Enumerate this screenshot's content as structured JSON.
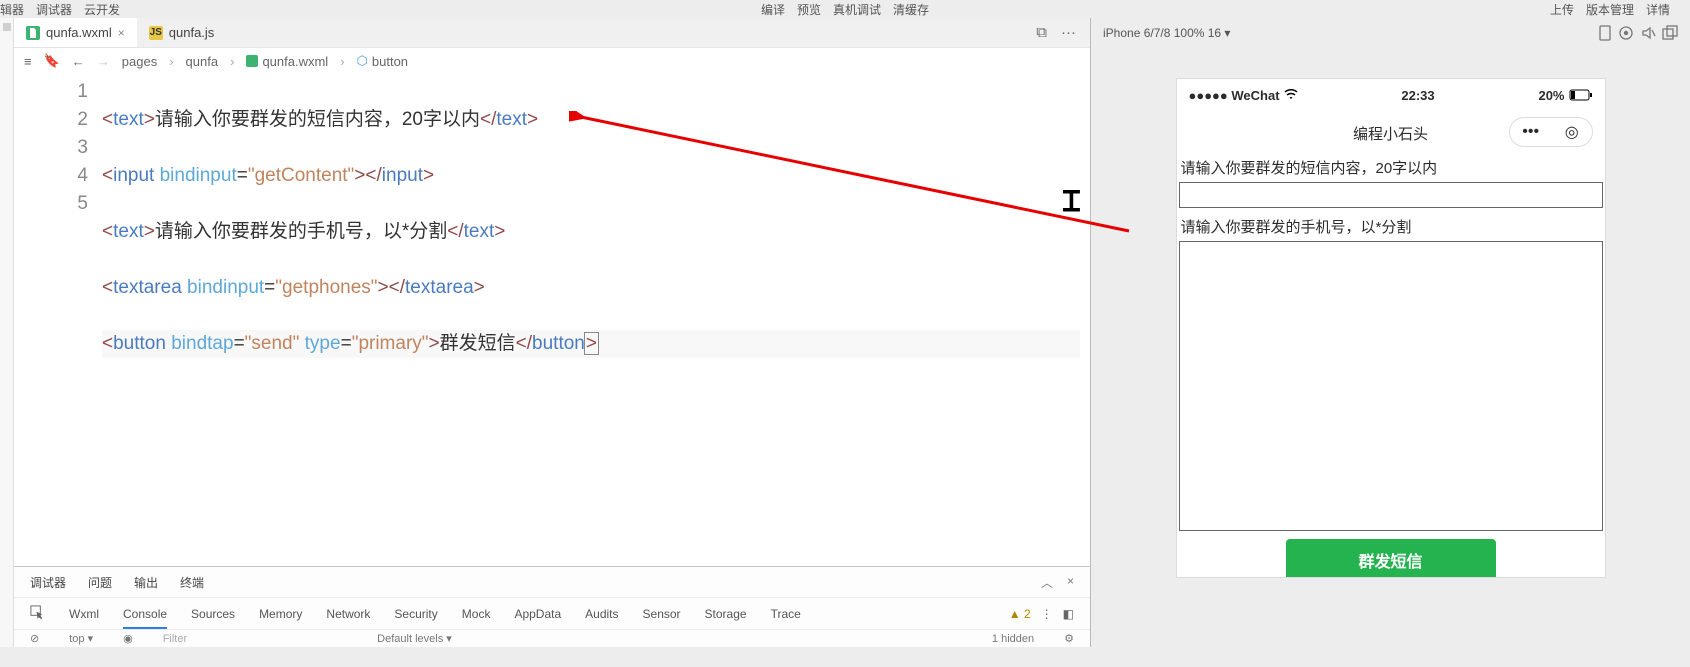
{
  "menu": {
    "left": [
      "辑器",
      "调试器",
      "云开发"
    ],
    "center": [
      "编译",
      "预览",
      "真机调试",
      "清缓存"
    ],
    "right": [
      "上传",
      "版本管理",
      "详情"
    ]
  },
  "tabs": {
    "items": [
      {
        "name": "qunfa.wxml",
        "active": true,
        "iconClass": "icon-wxml",
        "iconTxt": ""
      },
      {
        "name": "qunfa.js",
        "active": false,
        "iconClass": "icon-js",
        "iconTxt": "JS"
      }
    ],
    "splitTip": "⧉",
    "moreTip": "···"
  },
  "subbar": {
    "icons": [
      "≡",
      "🔖"
    ],
    "navBack": "←",
    "navFwd": "→",
    "crumbs": [
      "pages",
      "qunfa",
      "qunfa.wxml",
      "button"
    ]
  },
  "code": {
    "lines": [
      "1",
      "2",
      "3",
      "4",
      "5"
    ],
    "l1": {
      "tag": "text",
      "txt": "请输入你要群发的短信内容，20字以内"
    },
    "l2": {
      "tag": "input",
      "attr": "bindinput",
      "val": "getContent"
    },
    "l3": {
      "tag": "text",
      "txt": "请输入你要群发的手机号，以*分割"
    },
    "l4": {
      "tag": "textarea",
      "attr": "bindinput",
      "val": "getphones"
    },
    "l5": {
      "tag": "button",
      "attr1": "bindtap",
      "val1": "send",
      "attr2": "type",
      "val2": "primary",
      "txt": "群发短信"
    }
  },
  "bottom": {
    "tabs": [
      "调试器",
      "问题",
      "输出",
      "终端"
    ],
    "close": "×",
    "up": "︿",
    "tools": [
      "Wxml",
      "Console",
      "Sources",
      "Memory",
      "Network",
      "Security",
      "Mock",
      "AppData",
      "Audits",
      "Sensor",
      "Storage",
      "Trace"
    ],
    "activeTool": "Console",
    "warnCount": "2",
    "filter": {
      "top": "top",
      "eye": "◉",
      "ph": "Filter",
      "levels": "Default levels ▾",
      "hidden": "1 hidden"
    }
  },
  "sim": {
    "device": "iPhone 6/7/8 100% 16 ▾",
    "status": {
      "carrier": "●●●●● WeChat",
      "wifi": "⋮",
      "time": "22:33",
      "batt": "20%"
    },
    "title": "编程小石头",
    "caps": {
      "dots": "•••",
      "target": "◎"
    },
    "lbl1": "请输入你要群发的短信内容，20字以内",
    "lbl2": "请输入你要群发的手机号，以*分割",
    "btn": "群发短信"
  }
}
